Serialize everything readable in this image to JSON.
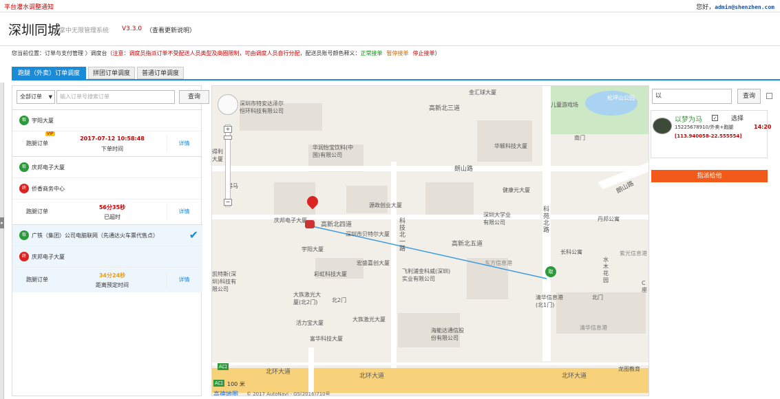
{
  "topbar": {
    "notice": "平台灌水调整通知",
    "greeting": "您好，",
    "user": "admin@shenzhen.com"
  },
  "header": {
    "title": "深圳同城",
    "subtitle": "掌中无限管理系统",
    "version": "V3.3.0",
    "update_link": "（查看更新说明）"
  },
  "breadcrumb": {
    "prefix": "您当前位置：订单与支付管理 〉调度台",
    "warning": "（注意：调度员指派订单不受配送人员类型及商圈限制，可由调度人员自行分配，",
    "legend_label": "配送员账号颜色释义：",
    "normal": "正常接单",
    "paused": "暂停接单",
    "stopped": "停止接单",
    "suffix": "）"
  },
  "tabs": [
    {
      "label": "跑腿（外卖）订单调度",
      "active": true
    },
    {
      "label": "拼团订单调度",
      "active": false
    },
    {
      "label": "普通订单调度",
      "active": false
    }
  ],
  "search": {
    "filter": "全部订单",
    "placeholder": "输入订单号搜索订单",
    "button": "查询"
  },
  "orders": [
    {
      "pickup": "宇阳大厦",
      "pickup_badge": "取",
      "type": "跑腿订单",
      "vip": "VIP",
      "value": "2017-07-12 10:58:48",
      "label": "下单时间",
      "detail": "详情"
    },
    {
      "pickup": "庆邦电子大厦",
      "pickup_badge": "取",
      "dropoff": "侨香商务中心",
      "dropoff_badge": "终",
      "type": "跑腿订单",
      "value": "56分35秒",
      "label": "已超时",
      "detail": "详情"
    },
    {
      "pickup": "广铁（集团）公司电脑联网（先通达火车票代售点）",
      "pickup_badge": "取",
      "dropoff": "庆邦电子大厦",
      "dropoff_badge": "终",
      "type": "跑腿订单",
      "value": "34分24秒",
      "label": "距离预定时间",
      "detail": "详情",
      "selected": true
    }
  ],
  "map": {
    "roads": [
      "朗山路",
      "朗山路",
      "高新北三道",
      "高新北四道",
      "高新北五道",
      "北环大道",
      "北环大道",
      "北环大道",
      "科苑北路",
      "科技北一路"
    ],
    "pois": [
      "金汇球大厦",
      "儿童游戏场",
      "松坪山公园",
      "华颖科技大厦",
      "健康元大厦",
      "源政创业大厦",
      "深圳大学业有限公司",
      "丹邦公寓",
      "庆邦电子大厦",
      "深圳市贝特尔大厦",
      "宇阳大厦",
      "长科公寓",
      "宏盛嘉创大厦",
      "彩虹科技大厦",
      "飞利浦金科威(深圳)实业有限公司",
      "大族激光大厦(北2门)",
      "活力宝大厦",
      "大族激光大厦",
      "清华信息港(北1门)",
      "富华科技大厦",
      "海能达通信股份有限公司",
      "龙图教育",
      "深圳市特安达泽尔恒环科技有限公司",
      "华润怡宝饮料(中国)有限公司",
      "北门",
      "北2门",
      "南门",
      "清华信息港",
      "紫光信息港",
      "东方信息港",
      "水木花园",
      "C座",
      "得马",
      "凯特斯(深圳)科技有限公司",
      "得利大厦"
    ],
    "scale": "100 米",
    "copyright": "© 2017 AutoNavi - GS(2016)710号",
    "logo": "高德地图",
    "badges": [
      "A口",
      "A口"
    ],
    "marker_start": "取"
  },
  "rider_panel": {
    "input_value": "以",
    "button": "查询",
    "rider": {
      "name": "以梦为马",
      "select_label": "选择",
      "phone_type": "15225678910/外卖+跑腿",
      "time": "14:20",
      "coords": "[113.940058-22.555554]",
      "assign": "指派给他"
    }
  }
}
